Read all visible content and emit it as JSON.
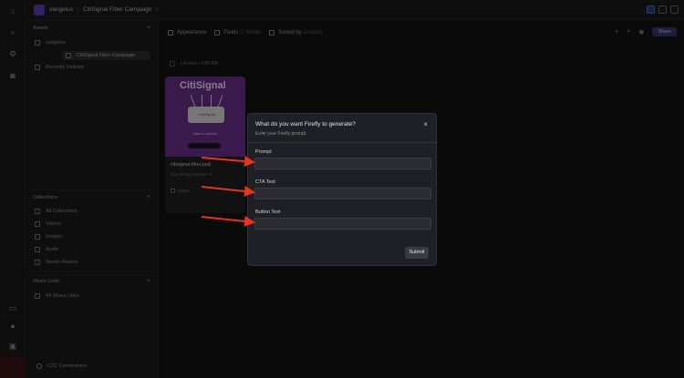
{
  "topbar": {
    "org": "vangelus",
    "current": "CitiSignal Fiber Campaign"
  },
  "sidebar": {
    "assets_title": "Assets",
    "items": [
      {
        "label": "vangelus"
      },
      {
        "label": "CitiSignal Fiber Campaign"
      },
      {
        "label": "Recently Deleted"
      }
    ],
    "collections_title": "Collections",
    "collections": [
      {
        "label": "All Collections"
      },
      {
        "label": "Videos"
      },
      {
        "label": "Images"
      },
      {
        "label": "Audio"
      },
      {
        "label": "Needs Review"
      }
    ],
    "share_links_title": "Share Links",
    "share_links": [
      {
        "label": "All Share Links"
      }
    ],
    "bottom": "C2C Connections"
  },
  "toolbar": {
    "appearance": "Appearance",
    "fields": "Fields",
    "fields_count": "1 Visible",
    "sorted_by": "Sorted by",
    "sort_value": "Custom",
    "share": "Share"
  },
  "grid": {
    "select_info": "1 Assets • 4.89 MB"
  },
  "card": {
    "brand": "CitiSignal",
    "router_text": "• CitiSignal",
    "tagline": "Start to stretch",
    "name": "citisignal-fiber.psd",
    "meta": "Nov 09 Tag Version • 4...",
    "tag": "Status"
  },
  "modal": {
    "title": "What do you want Firefly to generate?",
    "subtitle": "Enter your Firefly prompt.",
    "fields": [
      {
        "label": "Prompt",
        "value": ""
      },
      {
        "label": "CTA Text",
        "value": ""
      },
      {
        "label": "Button Text",
        "value": ""
      }
    ],
    "submit": "Submit",
    "close": "×"
  },
  "colors": {
    "accent": "#5b3fb8",
    "thumb": "#6b2f8a",
    "arrow": "#e8331e"
  }
}
